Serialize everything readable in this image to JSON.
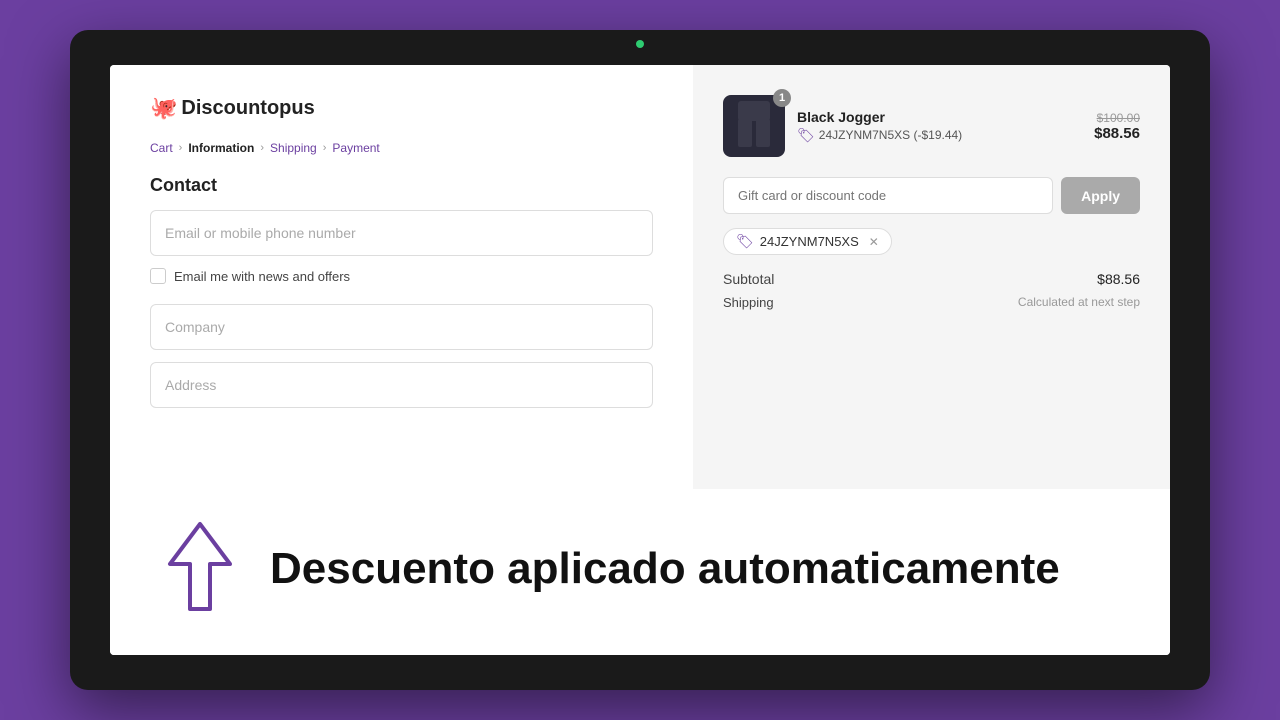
{
  "laptop": {
    "camera_color": "#2ecc71"
  },
  "breadcrumb": {
    "items": [
      {
        "label": "Cart",
        "active": false
      },
      {
        "label": "Information",
        "active": true
      },
      {
        "label": "Shipping",
        "active": false
      },
      {
        "label": "Payment",
        "active": false
      }
    ]
  },
  "contact": {
    "title": "Contact",
    "email_placeholder": "Email or mobile phone number",
    "newsletter_label": "Email me with news and offers"
  },
  "address": {
    "company_placeholder": "Company",
    "address_placeholder": "Address"
  },
  "product": {
    "name": "Black Jogger",
    "code": "24JZYNM7N5XS (-$19.44)",
    "price_original": "$100.00",
    "price_current": "$88.56",
    "badge": "1"
  },
  "discount": {
    "input_placeholder": "Gift card or discount code",
    "apply_label": "Apply",
    "applied_code": "24JZYNM7N5XS"
  },
  "totals": {
    "subtotal_label": "Subtotal",
    "subtotal_value": "$88.56",
    "shipping_label": "Shipping",
    "shipping_value": "Calculated at next step"
  },
  "overlay": {
    "message": "Descuento aplicado automaticamente"
  },
  "logo": {
    "text": "Discountopus"
  }
}
